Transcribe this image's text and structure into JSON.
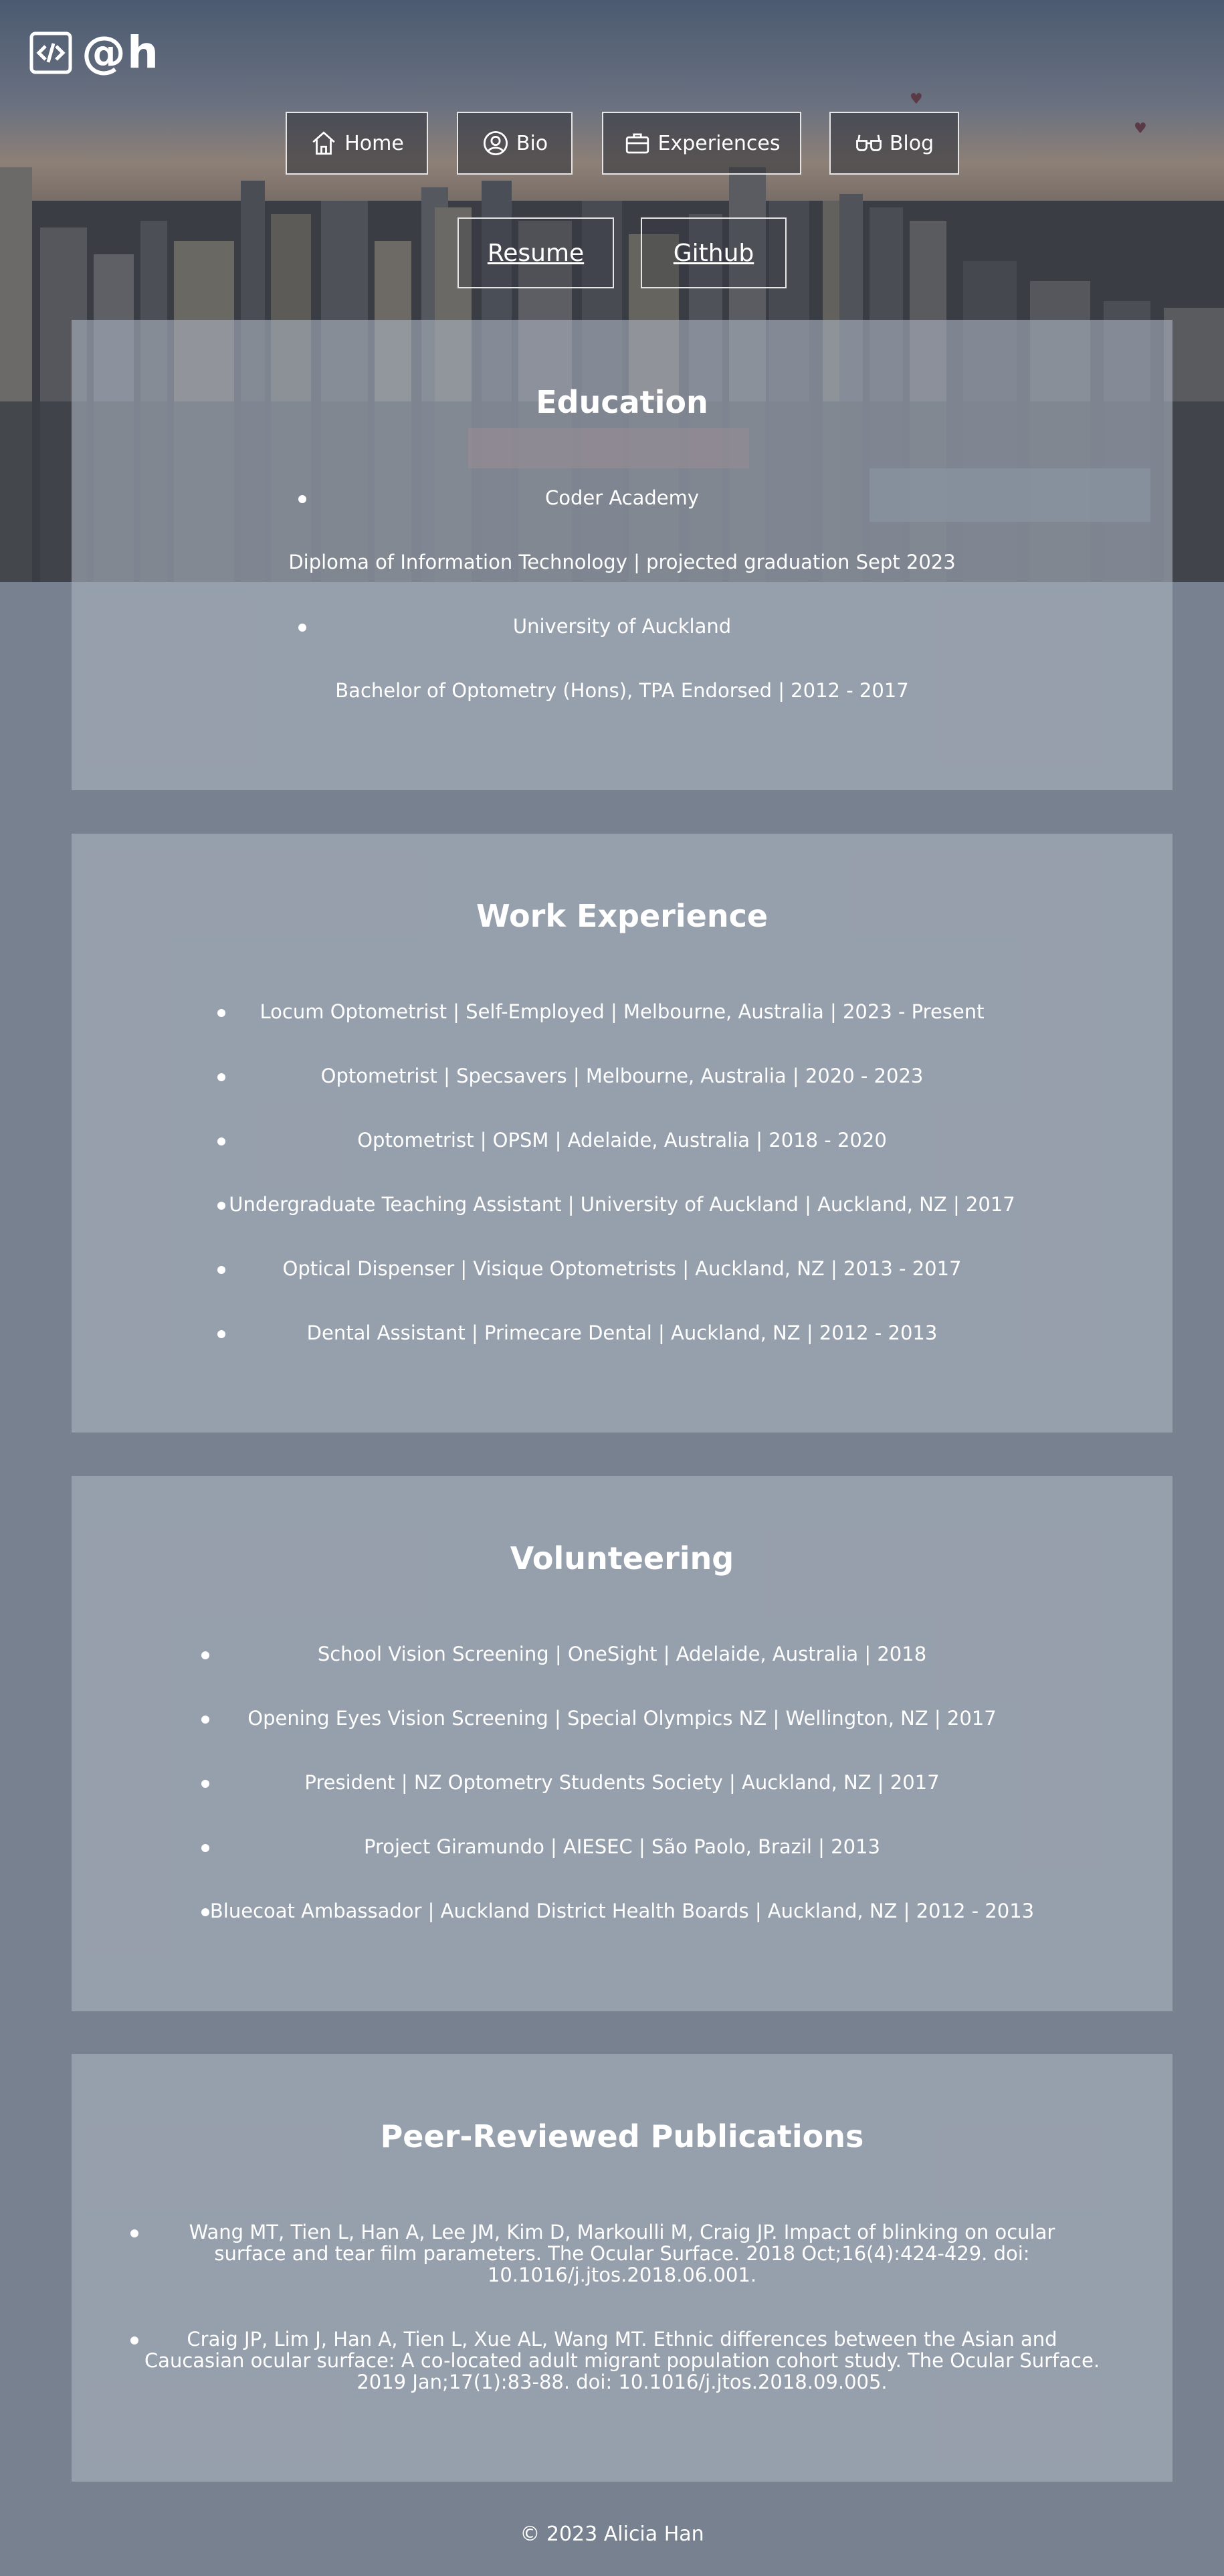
{
  "brand": {
    "logo_text": "@h",
    "logo_icon": "code-icon"
  },
  "nav": {
    "home": "Home",
    "bio": "Bio",
    "experiences": "Experiences",
    "blog": "Blog",
    "resume": "Resume",
    "github": "Github"
  },
  "education": {
    "title": "Education",
    "items": [
      {
        "school": "Coder Academy",
        "detail": "Diploma of Information Technology | projected graduation Sept 2023"
      },
      {
        "school": "University of Auckland",
        "detail": "Bachelor of Optometry (Hons), TPA Endorsed | 2012 - 2017"
      }
    ]
  },
  "work": {
    "title": "Work Experience",
    "items": [
      "Locum Optometrist | Self-Employed | Melbourne, Australia | 2023 - Present",
      "Optometrist | Specsavers | Melbourne, Australia | 2020 - 2023",
      "Optometrist | OPSM | Adelaide, Australia | 2018 - 2020",
      "Undergraduate Teaching Assistant | University of Auckland | Auckland, NZ | 2017",
      "Optical Dispenser | Visique Optometrists | Auckland, NZ | 2013 - 2017",
      "Dental Assistant | Primecare Dental | Auckland, NZ | 2012 - 2013"
    ]
  },
  "volunteering": {
    "title": "Volunteering",
    "items": [
      "School Vision Screening | OneSight | Adelaide, Australia | 2018",
      "Opening Eyes Vision Screening | Special Olympics NZ | Wellington, NZ | 2017",
      "President | NZ Optometry Students Society | Auckland, NZ | 2017",
      "Project Giramundo | AIESEC | São Paolo, Brazil | 2013",
      "Bluecoat Ambassador | Auckland District Health Boards | Auckland, NZ | 2012 - 2013"
    ]
  },
  "publications": {
    "title": "Peer-Reviewed Publications",
    "items": [
      {
        "line1": "Wang MT, Tien L, Han A, Lee JM, Kim D, Markoulli M, Craig JP. Impact of blinking on ocular",
        "line2": "surface and tear film parameters. The Ocular Surface. 2018 Oct;16(4):424-429. doi:",
        "line3": "10.1016/j.jtos.2018.06.001."
      },
      {
        "line1": "Craig JP, Lim J, Han A, Tien L, Xue AL, Wang MT. Ethnic differences between the Asian and",
        "line2": "Caucasian ocular surface: A co-located adult migrant population cohort study. The Ocular Surface.",
        "line3": "2019 Jan;17(1):83-88. doi: 10.1016/j.jtos.2018.09.005."
      }
    ]
  },
  "footer": {
    "text": "© 2023 Alicia Han"
  }
}
